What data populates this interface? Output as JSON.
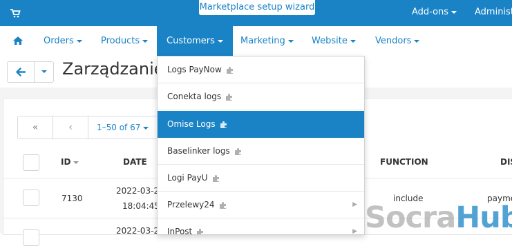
{
  "topbar": {
    "wizard_label": "Marketplace setup wizard",
    "addons_label": "Add-ons",
    "admin_label": "Administ"
  },
  "nav": {
    "items": [
      {
        "label": "Orders"
      },
      {
        "label": "Products"
      },
      {
        "label": "Customers"
      },
      {
        "label": "Marketing"
      },
      {
        "label": "Website"
      },
      {
        "label": "Vendors"
      }
    ]
  },
  "page": {
    "title": "Zarządzanie"
  },
  "pager": {
    "first": "«",
    "prev": "‹",
    "range": "1–50 of 67"
  },
  "table": {
    "headers": {
      "id": "ID",
      "date": "DATE",
      "function": "FUNCTION",
      "dis": "DIS"
    },
    "rows": [
      {
        "id": "7130",
        "date_line1": "2022-03-2",
        "time": "18:04:45",
        "function": "include",
        "extra": "paymen"
      },
      {
        "id": "",
        "date_line1": "2022-03-2",
        "time": "",
        "function": "",
        "extra": ""
      }
    ]
  },
  "dropdown": {
    "items": [
      {
        "label": "Logs PayNow",
        "submenu": false
      },
      {
        "label": "Conekta logs",
        "submenu": false
      },
      {
        "label": "Omise Logs",
        "submenu": false,
        "highlighted": true
      },
      {
        "label": "Baselinker logs",
        "submenu": false
      },
      {
        "label": "Logi PayU",
        "submenu": false
      },
      {
        "label": "Przelewy24",
        "submenu": true
      },
      {
        "label": "InPost",
        "submenu": true
      }
    ]
  },
  "watermark": {
    "part1": "Socra",
    "part2": "Hub"
  },
  "colors": {
    "accent": "#1a83c6",
    "background": "#f4f4f5"
  }
}
